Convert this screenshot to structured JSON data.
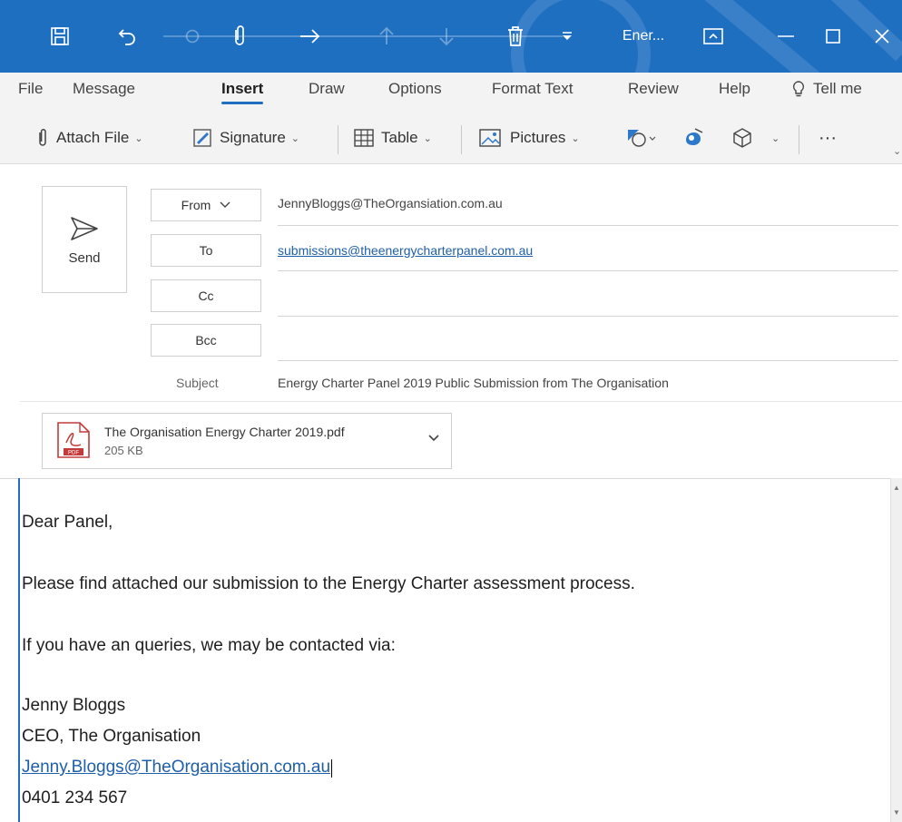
{
  "titlebar": {
    "title": "Ener...",
    "icons": [
      "save-icon",
      "undo-icon",
      "redo-icon",
      "attach-icon",
      "next-icon",
      "up-icon",
      "down-icon",
      "delete-icon",
      "customize-icon",
      "ribbon-display-icon",
      "minimize-icon",
      "maximize-icon",
      "close-icon"
    ],
    "accent": "#1f6fc1"
  },
  "tabs": [
    {
      "label": "File"
    },
    {
      "label": "Message"
    },
    {
      "label": "Insert",
      "active": true
    },
    {
      "label": "Draw"
    },
    {
      "label": "Options"
    },
    {
      "label": "Format Text"
    },
    {
      "label": "Review"
    },
    {
      "label": "Help"
    },
    {
      "label": "Tell me"
    }
  ],
  "toolbar": {
    "attach_file": "Attach File",
    "signature": "Signature",
    "table": "Table",
    "pictures": "Pictures",
    "more": "···"
  },
  "compose": {
    "send_label": "Send",
    "from_label": "From",
    "to_label": "To",
    "cc_label": "Cc",
    "bcc_label": "Bcc",
    "subject_label": "Subject",
    "from_value": "JennyBloggs@TheOrgansiation.com.au",
    "to_value": "submissions@theenergycharterpanel.com.au",
    "cc_value": "",
    "bcc_value": "",
    "subject_value": "Energy Charter Panel 2019 Public Submission from The Organisation"
  },
  "attachment": {
    "name": "The Organisation Energy Charter 2019.pdf",
    "size": "205 KB",
    "icon_label": "PDF"
  },
  "message": {
    "greeting": "Dear Panel,",
    "line1": "Please find attached our submission to the Energy Charter assessment process.",
    "line2": "If you have an queries, we may be contacted via:",
    "sig_name": "Jenny Bloggs",
    "sig_title": "CEO, The Organisation",
    "sig_email": "Jenny.Bloggs@TheOrganisation.com.au",
    "sig_phone": "0401 234 567"
  }
}
